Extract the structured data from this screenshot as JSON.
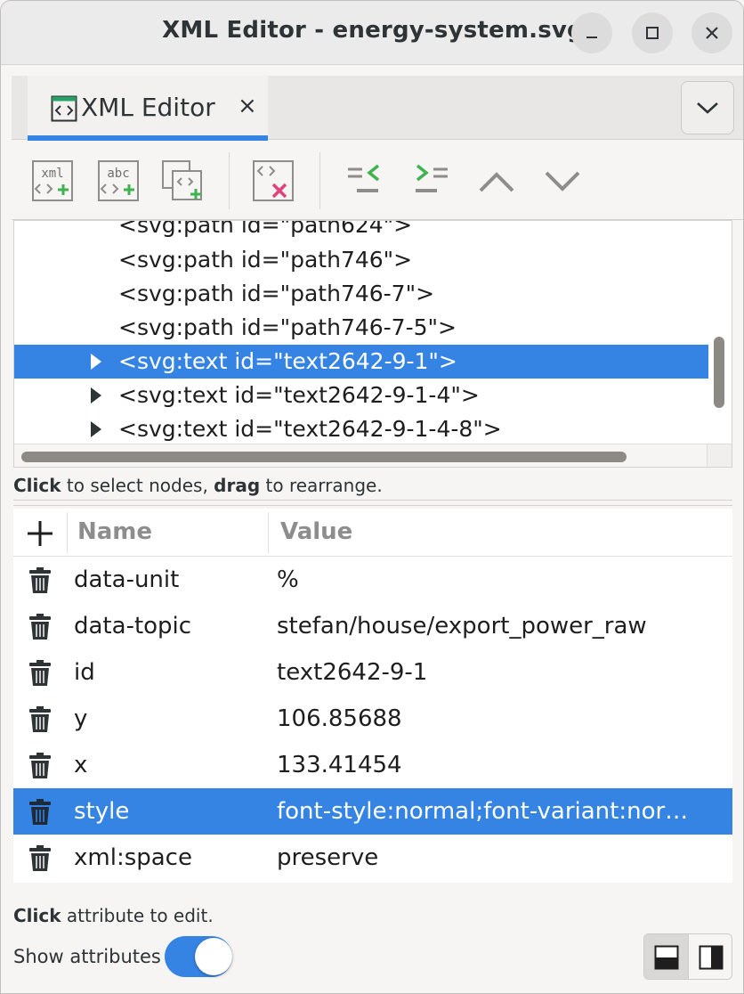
{
  "window": {
    "title": "XML Editor - energy-system.svg"
  },
  "dock": {
    "tab_label": "XML Editor",
    "tab_close": "×"
  },
  "toolbar": {
    "buttons": [
      "new-element-node",
      "new-text-node",
      "duplicate-node",
      "delete-node",
      "unindent-node",
      "indent-node",
      "raise-node",
      "lower-node"
    ]
  },
  "tree": {
    "nodes": [
      {
        "label": "<svg:path id=\"path624\">",
        "expandable": false,
        "selected": false
      },
      {
        "label": "<svg:path id=\"path746\">",
        "expandable": false,
        "selected": false
      },
      {
        "label": "<svg:path id=\"path746-7\">",
        "expandable": false,
        "selected": false
      },
      {
        "label": "<svg:path id=\"path746-7-5\">",
        "expandable": false,
        "selected": false
      },
      {
        "label": "<svg:text id=\"text2642-9-1\">",
        "expandable": true,
        "selected": true
      },
      {
        "label": "<svg:text id=\"text2642-9-1-4\">",
        "expandable": true,
        "selected": false
      },
      {
        "label": "<svg:text id=\"text2642-9-1-4-8\">",
        "expandable": true,
        "selected": false
      }
    ],
    "hint_bold1": "Click",
    "hint_text1": " to select nodes, ",
    "hint_bold2": "drag",
    "hint_text2": " to rearrange."
  },
  "attributes": {
    "add_symbol": "+",
    "col_name": "Name",
    "col_value": "Value",
    "rows": [
      {
        "name": "data-unit",
        "value": "%"
      },
      {
        "name": "data-topic",
        "value": "stefan/house/export_power_raw"
      },
      {
        "name": "id",
        "value": "text2642-9-1"
      },
      {
        "name": "y",
        "value": "106.85688"
      },
      {
        "name": "x",
        "value": "133.41454"
      },
      {
        "name": "style",
        "value": "font-style:normal;font-variant:nor…"
      },
      {
        "name": "xml:space",
        "value": "preserve"
      }
    ],
    "selected_row": "style",
    "hint_bold": "Click",
    "hint_text": " attribute to edit."
  },
  "footer": {
    "show_attributes_label": "Show attributes",
    "show_attributes_on": true
  },
  "colors": {
    "accent": "#3584e4",
    "add_green": "#3fb34f",
    "delete_pink": "#e0417a"
  }
}
